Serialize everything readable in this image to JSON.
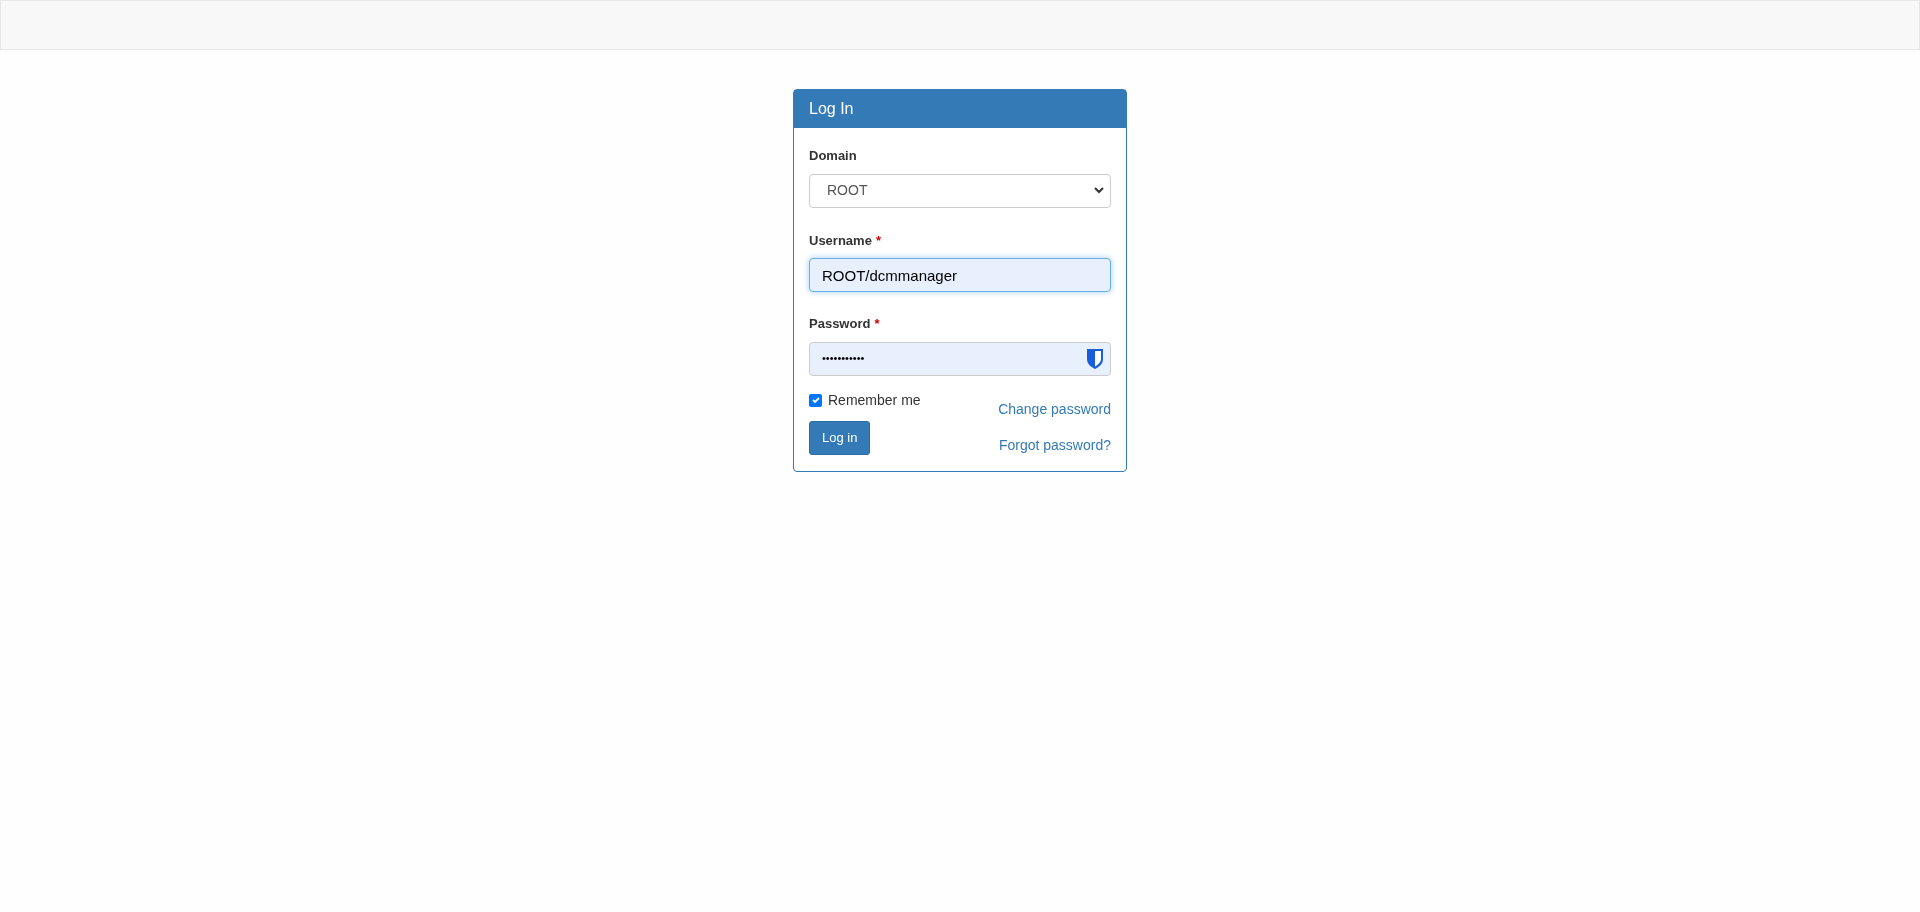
{
  "panel": {
    "title": "Log In"
  },
  "domain": {
    "label": "Domain",
    "value": "ROOT"
  },
  "username": {
    "label": "Username",
    "required_mark": "*",
    "value": "ROOT/dcmmanager"
  },
  "password": {
    "label": "Password",
    "required_mark": "*",
    "value": "•••••••••••"
  },
  "remember": {
    "label": "Remember me",
    "checked": true
  },
  "login_button": "Log in",
  "links": [
    "Change password",
    "Forgot password?"
  ]
}
